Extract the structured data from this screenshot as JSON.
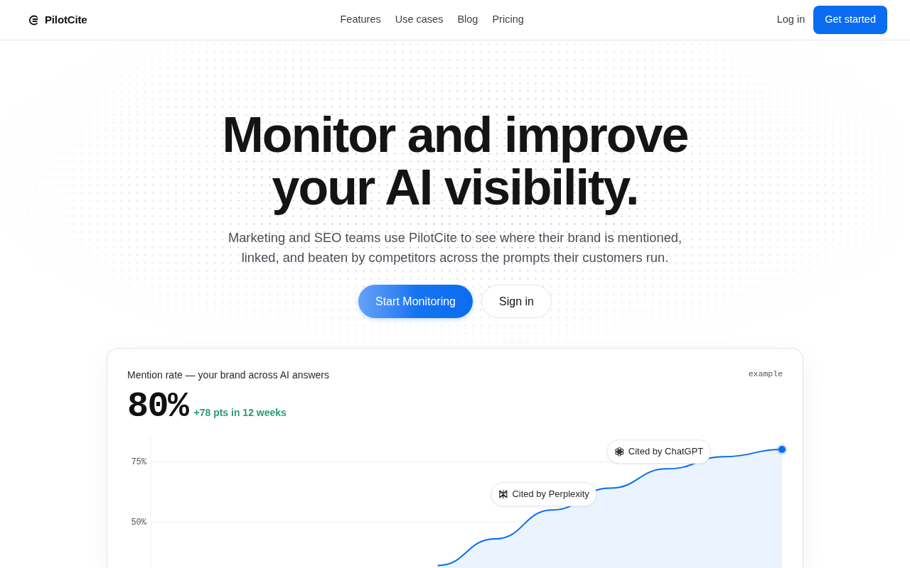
{
  "header": {
    "logo": "PilotCite",
    "nav": [
      "Features",
      "Use cases",
      "Blog",
      "Pricing"
    ],
    "login": "Log in",
    "cta": "Get started"
  },
  "hero": {
    "title_lines": [
      "Monitor and improve",
      "your AI visibility."
    ],
    "subtitle": "Marketing and SEO teams use PilotCite to see where their brand is mentioned, linked, and beaten by competitors across the prompts their customers run.",
    "primary_button": "Start Monitoring",
    "secondary_button": "Sign in"
  },
  "card": {
    "title": "Mention rate — your brand across AI answers",
    "tag": "example",
    "value": "80%",
    "change": "+78 pts in 12 weeks",
    "chart_data": {
      "type": "area",
      "ylim": [
        31,
        85
      ],
      "yticks": [
        {
          "value": 50,
          "label": "50%"
        },
        {
          "value": 75,
          "label": "75%"
        }
      ],
      "series": [
        {
          "color": "#0a6cf0",
          "values": [
            null,
            null,
            null,
            null,
            null,
            32,
            43,
            55,
            64,
            72,
            77,
            80
          ]
        }
      ],
      "annotations": [
        "Cited by Perplexity",
        "Cited by ChatGPT"
      ]
    }
  }
}
